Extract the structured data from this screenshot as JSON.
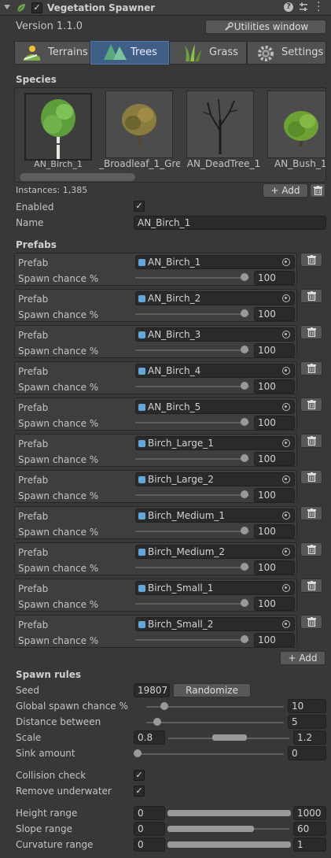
{
  "header": {
    "title": "Vegetation Spawner",
    "help_icon": "help-icon",
    "settings_icon": "settings-sliders-icon",
    "menu_icon": "kebab-menu-icon"
  },
  "version": "Version 1.1.0",
  "utilities_button": "Utilities window",
  "tabs": [
    "Terrains",
    "Trees",
    "Grass",
    "Settings"
  ],
  "species": {
    "heading": "Species",
    "items": [
      "AN_Birch_1",
      "_Broadleaf_1_Gre",
      "AN_DeadTree_1",
      "AN_Bush_1"
    ],
    "selected": 0,
    "instances": "Instances: 1,385",
    "add_button": "Add"
  },
  "enabled_label": "Enabled",
  "name_label": "Name",
  "name_value": "AN_Birch_1",
  "prefabs": {
    "heading": "Prefabs",
    "prefab_label": "Prefab",
    "spawn_label": "Spawn chance %",
    "items": [
      {
        "name": "AN_Birch_1",
        "chance": "100",
        "fraction": 1.0
      },
      {
        "name": "AN_Birch_2",
        "chance": "100",
        "fraction": 1.0
      },
      {
        "name": "AN_Birch_3",
        "chance": "100",
        "fraction": 1.0
      },
      {
        "name": "AN_Birch_4",
        "chance": "100",
        "fraction": 1.0
      },
      {
        "name": "AN_Birch_5",
        "chance": "100",
        "fraction": 1.0
      },
      {
        "name": "Birch_Large_1",
        "chance": "100",
        "fraction": 1.0
      },
      {
        "name": "Birch_Large_2",
        "chance": "100",
        "fraction": 1.0
      },
      {
        "name": "Birch_Medium_1",
        "chance": "100",
        "fraction": 1.0
      },
      {
        "name": "Birch_Medium_2",
        "chance": "100",
        "fraction": 1.0
      },
      {
        "name": "Birch_Small_1",
        "chance": "100",
        "fraction": 1.0
      },
      {
        "name": "Birch_Small_2",
        "chance": "100",
        "fraction": 1.0
      }
    ],
    "add_button": "Add"
  },
  "spawn_rules": {
    "heading": "Spawn rules",
    "seed_label": "Seed",
    "seed_value": "19807",
    "randomize": "Randomize",
    "global_label": "Global spawn chance %",
    "global_value": "10",
    "global_fraction": 0.1,
    "distance_label": "Distance between",
    "distance_value": "5",
    "distance_fraction": 0.05,
    "scale_label": "Scale",
    "scale_min": "0.8",
    "scale_max": "1.2",
    "sink_label": "Sink amount",
    "sink_value": "0",
    "sink_fraction": 0.0,
    "collision_label": "Collision check",
    "underwater_label": "Remove underwater",
    "height_label": "Height range",
    "height_min": "0",
    "height_max": "1000",
    "slope_label": "Slope range",
    "slope_min": "0",
    "slope_max": "60",
    "curvature_label": "Curvature range",
    "curvature_min": "0",
    "curvature_max": "1"
  },
  "colors": {
    "accent": "#3f5f86",
    "background": "#383838",
    "field": "#2a2a2a",
    "object_icon": "#5fa9de"
  }
}
